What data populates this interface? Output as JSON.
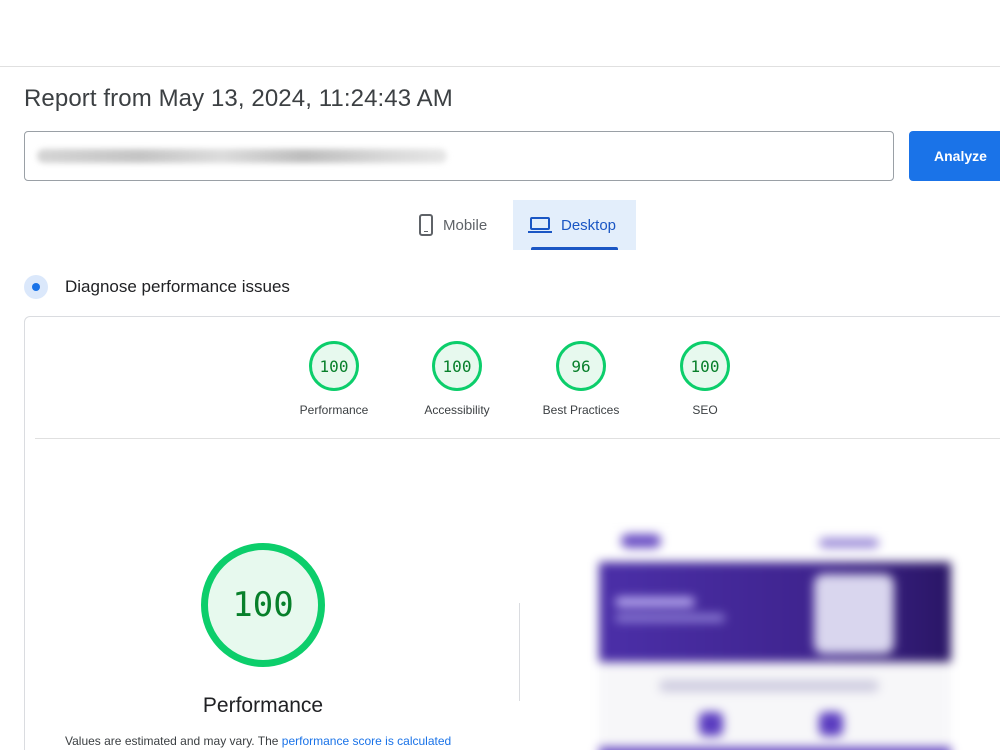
{
  "report": {
    "title": "Report from May 13, 2024, 11:24:43 AM"
  },
  "url_input": {
    "value": ""
  },
  "analyze_button": {
    "label": "Analyze"
  },
  "device_tabs": {
    "mobile": "Mobile",
    "desktop": "Desktop",
    "selected": "Desktop"
  },
  "diagnose": {
    "label": "Diagnose performance issues"
  },
  "scores": [
    {
      "label": "Performance",
      "score": "100"
    },
    {
      "label": "Accessibility",
      "score": "100"
    },
    {
      "label": "Best Practices",
      "score": "96"
    },
    {
      "label": "SEO",
      "score": "100"
    }
  ],
  "performance_detail": {
    "score": "100",
    "label": "Performance",
    "note_prefix": "Values are estimated and may vary. The ",
    "note_link": "performance score is calculated"
  },
  "colors": {
    "pass_green": "#0cce6b",
    "pass_text": "#08802b",
    "accent_blue": "#1a73e8",
    "selected_tab_bg": "#e3eefb"
  }
}
